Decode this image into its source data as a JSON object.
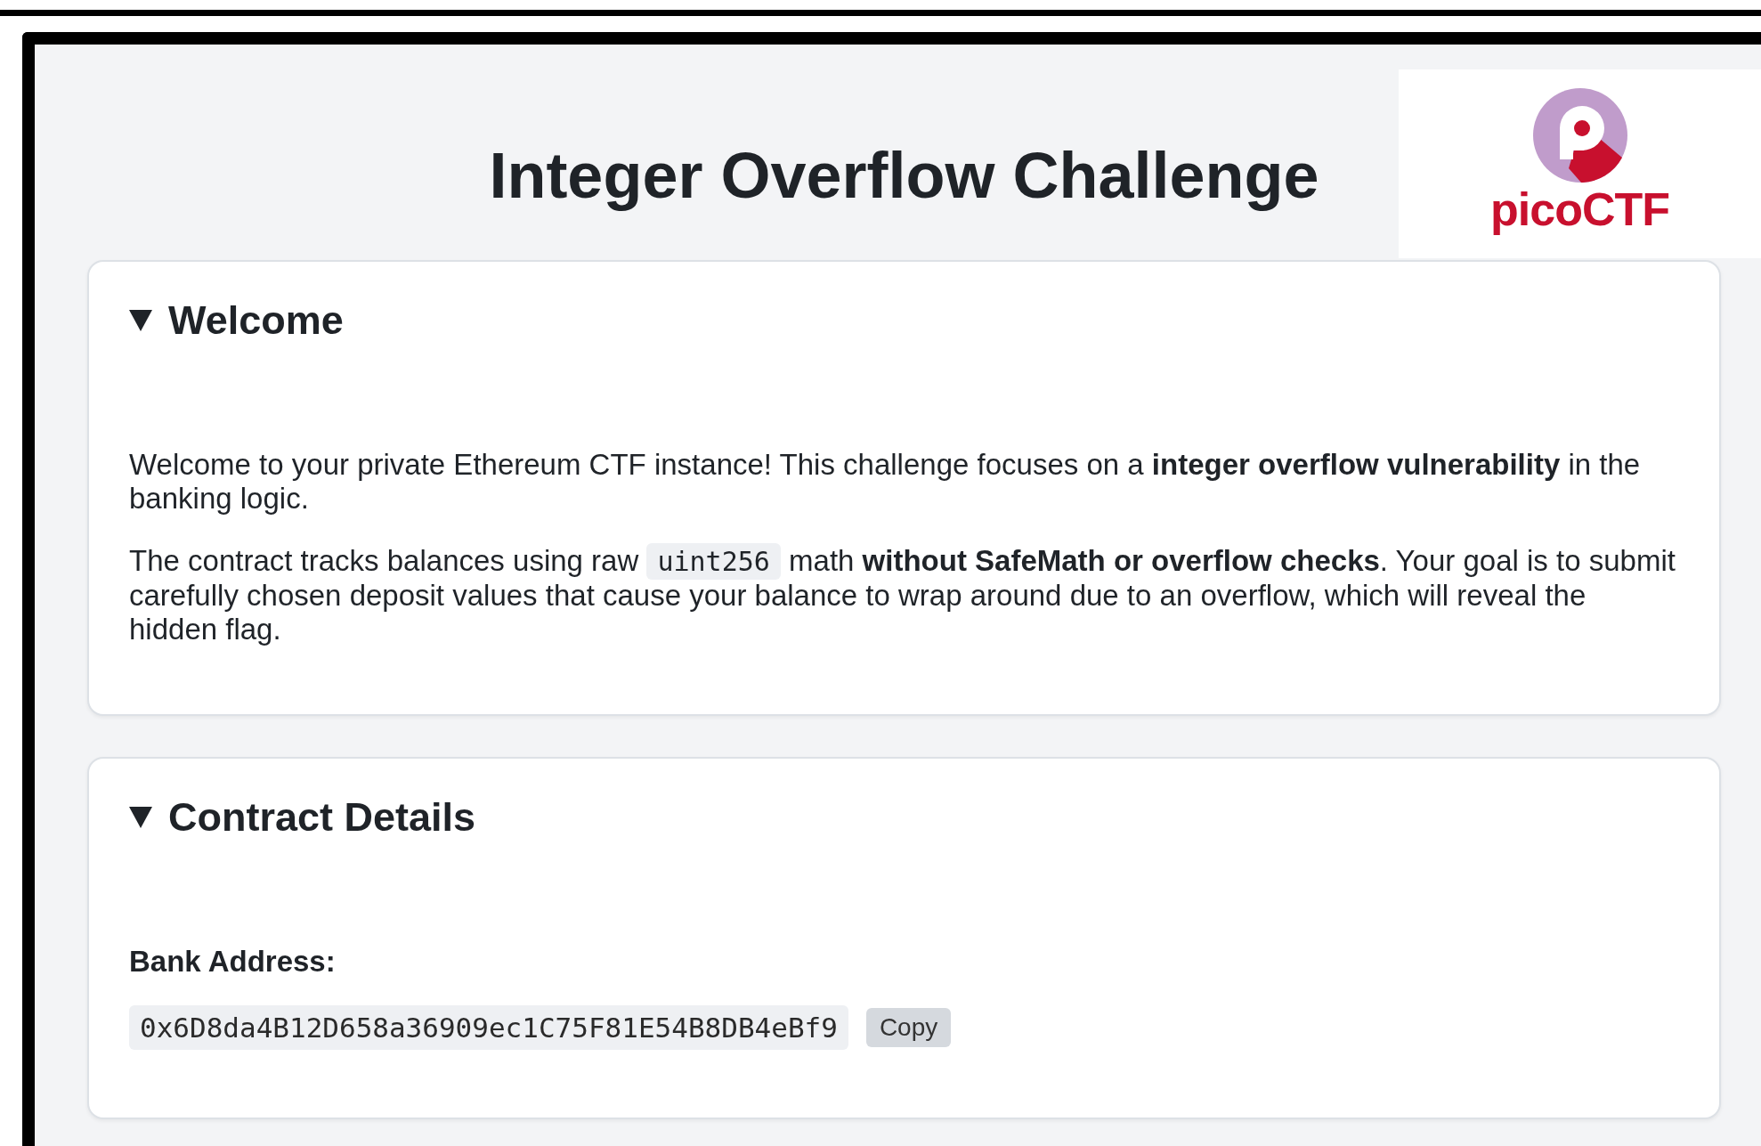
{
  "title": "Integer Overflow Challenge",
  "logo": {
    "text": "picoCTF"
  },
  "sections": [
    {
      "heading": "Welcome",
      "expanded": true,
      "paragraphs": [
        [
          {
            "kind": "text",
            "text": "Welcome to your private Ethereum CTF instance! This challenge focuses on a **integer overflow vulnerability** in the banking logic."
          }
        ],
        [
          {
            "kind": "text",
            "text": "The contract tracks balances using raw "
          },
          {
            "kind": "code",
            "text": "uint256"
          },
          {
            "kind": "text",
            "text": " math **without SafeMath or overflow checks**. Your goal is to submit carefully chosen deposit values that cause your balance to wrap around due to an overflow, which will reveal the hidden flag."
          }
        ]
      ]
    },
    {
      "heading": "Contract Details",
      "expanded": true,
      "field": {
        "label": "Bank Address:",
        "value": "0x6D8da4B12D658a36909ec1C75F81E54B8DB4eBf9",
        "button": "Copy"
      }
    }
  ]
}
